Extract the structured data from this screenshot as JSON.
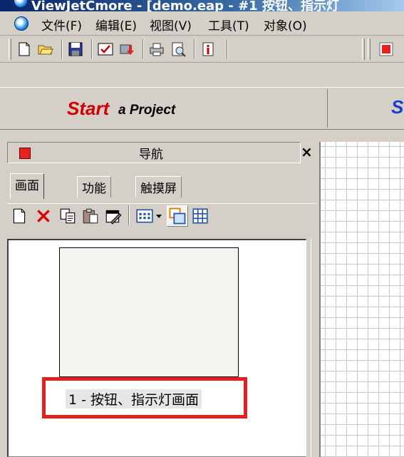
{
  "titlebar": {
    "text": "ViewJetCmore - [demo.eap - #1 按钮、指示灯"
  },
  "menu": {
    "items": [
      "文件(F)",
      "编辑(E)",
      "视图(V)",
      "工具(T)",
      "对象(O)"
    ]
  },
  "toolbar": {
    "icons": [
      "new-file-icon",
      "open-folder-icon",
      "save-icon",
      "checkbox-icon",
      "download-icon",
      "print-icon",
      "print-preview-icon",
      "info-icon",
      "red-square-icon"
    ]
  },
  "project_bar": {
    "start_word": "Start",
    "start_rest": "a Project",
    "cut_letter": "S"
  },
  "nav_panel": {
    "title": "导航",
    "close": "×",
    "tabs": [
      "画面",
      "功能",
      "触摸屏"
    ],
    "active_tab": 0,
    "tool_icons": [
      "new-page-icon",
      "delete-icon",
      "copy-icon",
      "paste-icon",
      "properties-icon",
      "view-mode-icon",
      "dropdown-arrow-icon",
      "thumbnail-view-icon",
      "grid-view-icon"
    ],
    "screens": [
      {
        "label": "1 - 按钮、指示灯画面"
      }
    ]
  },
  "colors": {
    "accent_red": "#e51e1e",
    "start_red": "#d00000",
    "s_blue": "#1a3cd0",
    "chrome": "#d4d0c8"
  }
}
